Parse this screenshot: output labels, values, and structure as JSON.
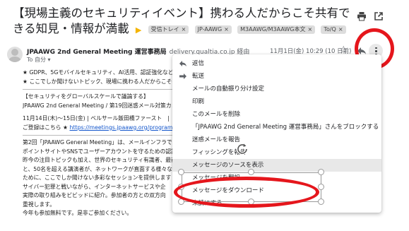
{
  "subject": {
    "title": "【現場主義のセキュリティイベント】携わる人だからこそ共有できる知見・情報が満載",
    "labels": [
      "受信トレイ",
      "JP-AAWG",
      "M3AAWG/M3AAWG本文",
      "To/Q"
    ]
  },
  "header_icons": {
    "print": "print-icon",
    "open_new_window": "open-in-new-icon"
  },
  "message": {
    "sender_name": "JPAAWG 2nd General Meeting 運営事務局",
    "sender_via": "delivery.qualtia.co.jp 経由",
    "to_line": "To 自分 ▾",
    "date": "11月1日(金) 10:29 (10 日前)",
    "icons": {
      "star": "star-icon",
      "reply": "reply-icon",
      "more": "more-vert-icon"
    }
  },
  "body_lines": {
    "l1": "★ GDPR、5Gモバイルセキュリティ、AI活用、認証強化など注",
    "l2": "★ ここでしか聞けないトピック、現場に携わる人だからこそ共",
    "l3": "【セキュリティをグローバルスケールで議論する】",
    "l4": "JPAAWG 2nd General Meeting / 第19回迷惑メール対策カンファ",
    "l5": "11月14日(木)～15日(金) | ベルサール飯田橋ファースト　|　参",
    "l6_prefix": "ご登録はこちら ★ ",
    "l6_link": "https://meetings.jpaawg.org/program/?1P1sk",
    "l7": "第2回「JPAAWG General Meeting」は、メールインフラでのGD",
    "l8": "ポイントサイトやSNSでユーザーアカウントを守るための認証",
    "l9": "昨今の注目トピックも加え、世界のセキュリティ有識者、最前",
    "l10": "と、50名を超える講演者が、ネットワークが直面する様々な脅",
    "l11": "ために、ここでしか聞けない多彩なセッションを提供します",
    "l12": "サイバー犯罪と戦いながら、インターネットサービスや企",
    "l13": "実際の取り組みをビビッドに紹介。参加者の方との双方向",
    "l14": "重視します。",
    "l15": "今年も参加無料です。是非ご参加ください。"
  },
  "menu": {
    "items": [
      {
        "label": "返信",
        "icon": "reply-icon"
      },
      {
        "label": "転送",
        "icon": "forward-icon"
      },
      {
        "label": "メールの自動振り分け設定"
      },
      {
        "label": "印刷"
      },
      {
        "label": "このメールを削除"
      },
      {
        "label": "「JPAAWG 2nd General Meeting 運営事務局」さんをブロックする"
      },
      {
        "label": "迷惑メールを報告"
      },
      {
        "label": "フィッシングを報告"
      },
      {
        "label": "メッセージのソースを表示",
        "highlighted": true
      },
      {
        "label": "メッセージを翻訳"
      },
      {
        "label": "メッセージをダウンロード"
      },
      {
        "label": "未読にする"
      }
    ]
  },
  "colors": {
    "annotation_red": "#e5161c",
    "menu_highlight": "#e8e8e8",
    "link": "#1155cc"
  }
}
